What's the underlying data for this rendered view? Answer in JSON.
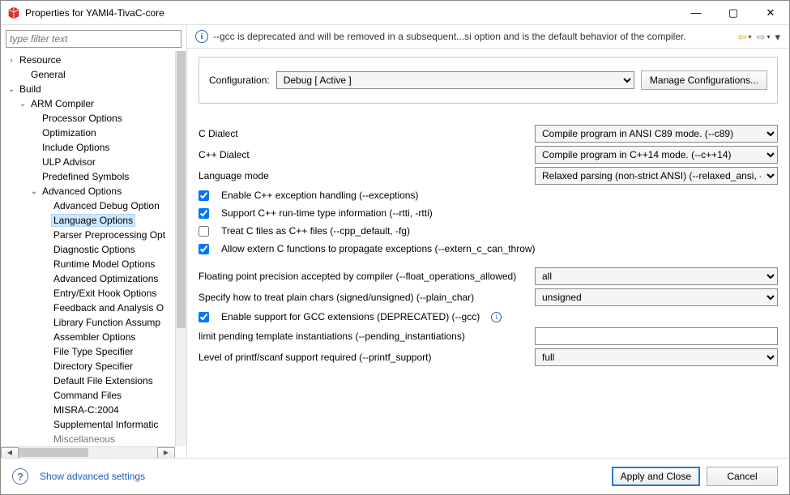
{
  "window": {
    "title": "Properties for YAMl4-TivaC-core"
  },
  "filter": {
    "placeholder": "type filter text"
  },
  "tree": {
    "resource": "Resource",
    "general": "General",
    "build": "Build",
    "arm": "ARM Compiler",
    "proc": "Processor Options",
    "opt": "Optimization",
    "include": "Include Options",
    "ulp": "ULP Advisor",
    "predef": "Predefined Symbols",
    "adv": "Advanced Options",
    "advdbg": "Advanced Debug Option",
    "lang": "Language Options",
    "parser": "Parser Preprocessing Opt",
    "diag": "Diagnostic Options",
    "runtime": "Runtime Model Options",
    "advopt": "Advanced Optimizations",
    "entry": "Entry/Exit Hook Options",
    "feedback": "Feedback and Analysis O",
    "libfunc": "Library Function Assump",
    "asm": "Assembler Options",
    "filetype": "File Type Specifier",
    "dirspec": "Directory Specifier",
    "defext": "Default File Extensions",
    "cmdfiles": "Command Files",
    "misra": "MISRA-C:2004",
    "supp": "Supplemental Informatic",
    "misc": "Miscellaneous"
  },
  "warnbar": {
    "message": "--gcc is deprecated and will be removed in a subsequent...si option and is the default behavior of the compiler."
  },
  "config": {
    "label": "Configuration:",
    "selected": "Debug  [ Active ]",
    "manage": "Manage Configurations..."
  },
  "form": {
    "c_dialect_label": "C Dialect",
    "c_dialect_value": "Compile program in ANSI C89 mode. (--c89)",
    "cpp_dialect_label": "C++ Dialect",
    "cpp_dialect_value": "Compile program in C++14 mode. (--c++14)",
    "lang_mode_label": "Language mode",
    "lang_mode_value": "Relaxed parsing (non-strict ANSI) (--relaxed_ansi, -pr)",
    "chk1": "Enable C++ exception handling (--exceptions)",
    "chk2": "Support C++ run-time type information (--rtti, -rtti)",
    "chk3": "Treat C files as C++ files (--cpp_default, -fg)",
    "chk4": "Allow extern C functions to propagate exceptions (--extern_c_can_throw)",
    "float_label": "Floating point precision accepted by compiler (--float_operations_allowed)",
    "float_value": "all",
    "plain_char_label": "Specify how to treat plain chars (signed/unsigned) (--plain_char)",
    "plain_char_value": "unsigned",
    "chk5": "Enable support for GCC extensions (DEPRECATED) (--gcc)",
    "pending_label": "limit pending template instantiations (--pending_instantiations)",
    "pending_value": "",
    "printf_label": "Level of printf/scanf support required (--printf_support)",
    "printf_value": "full"
  },
  "footer": {
    "advanced_link": "Show advanced settings",
    "apply": "Apply and Close",
    "cancel": "Cancel"
  }
}
